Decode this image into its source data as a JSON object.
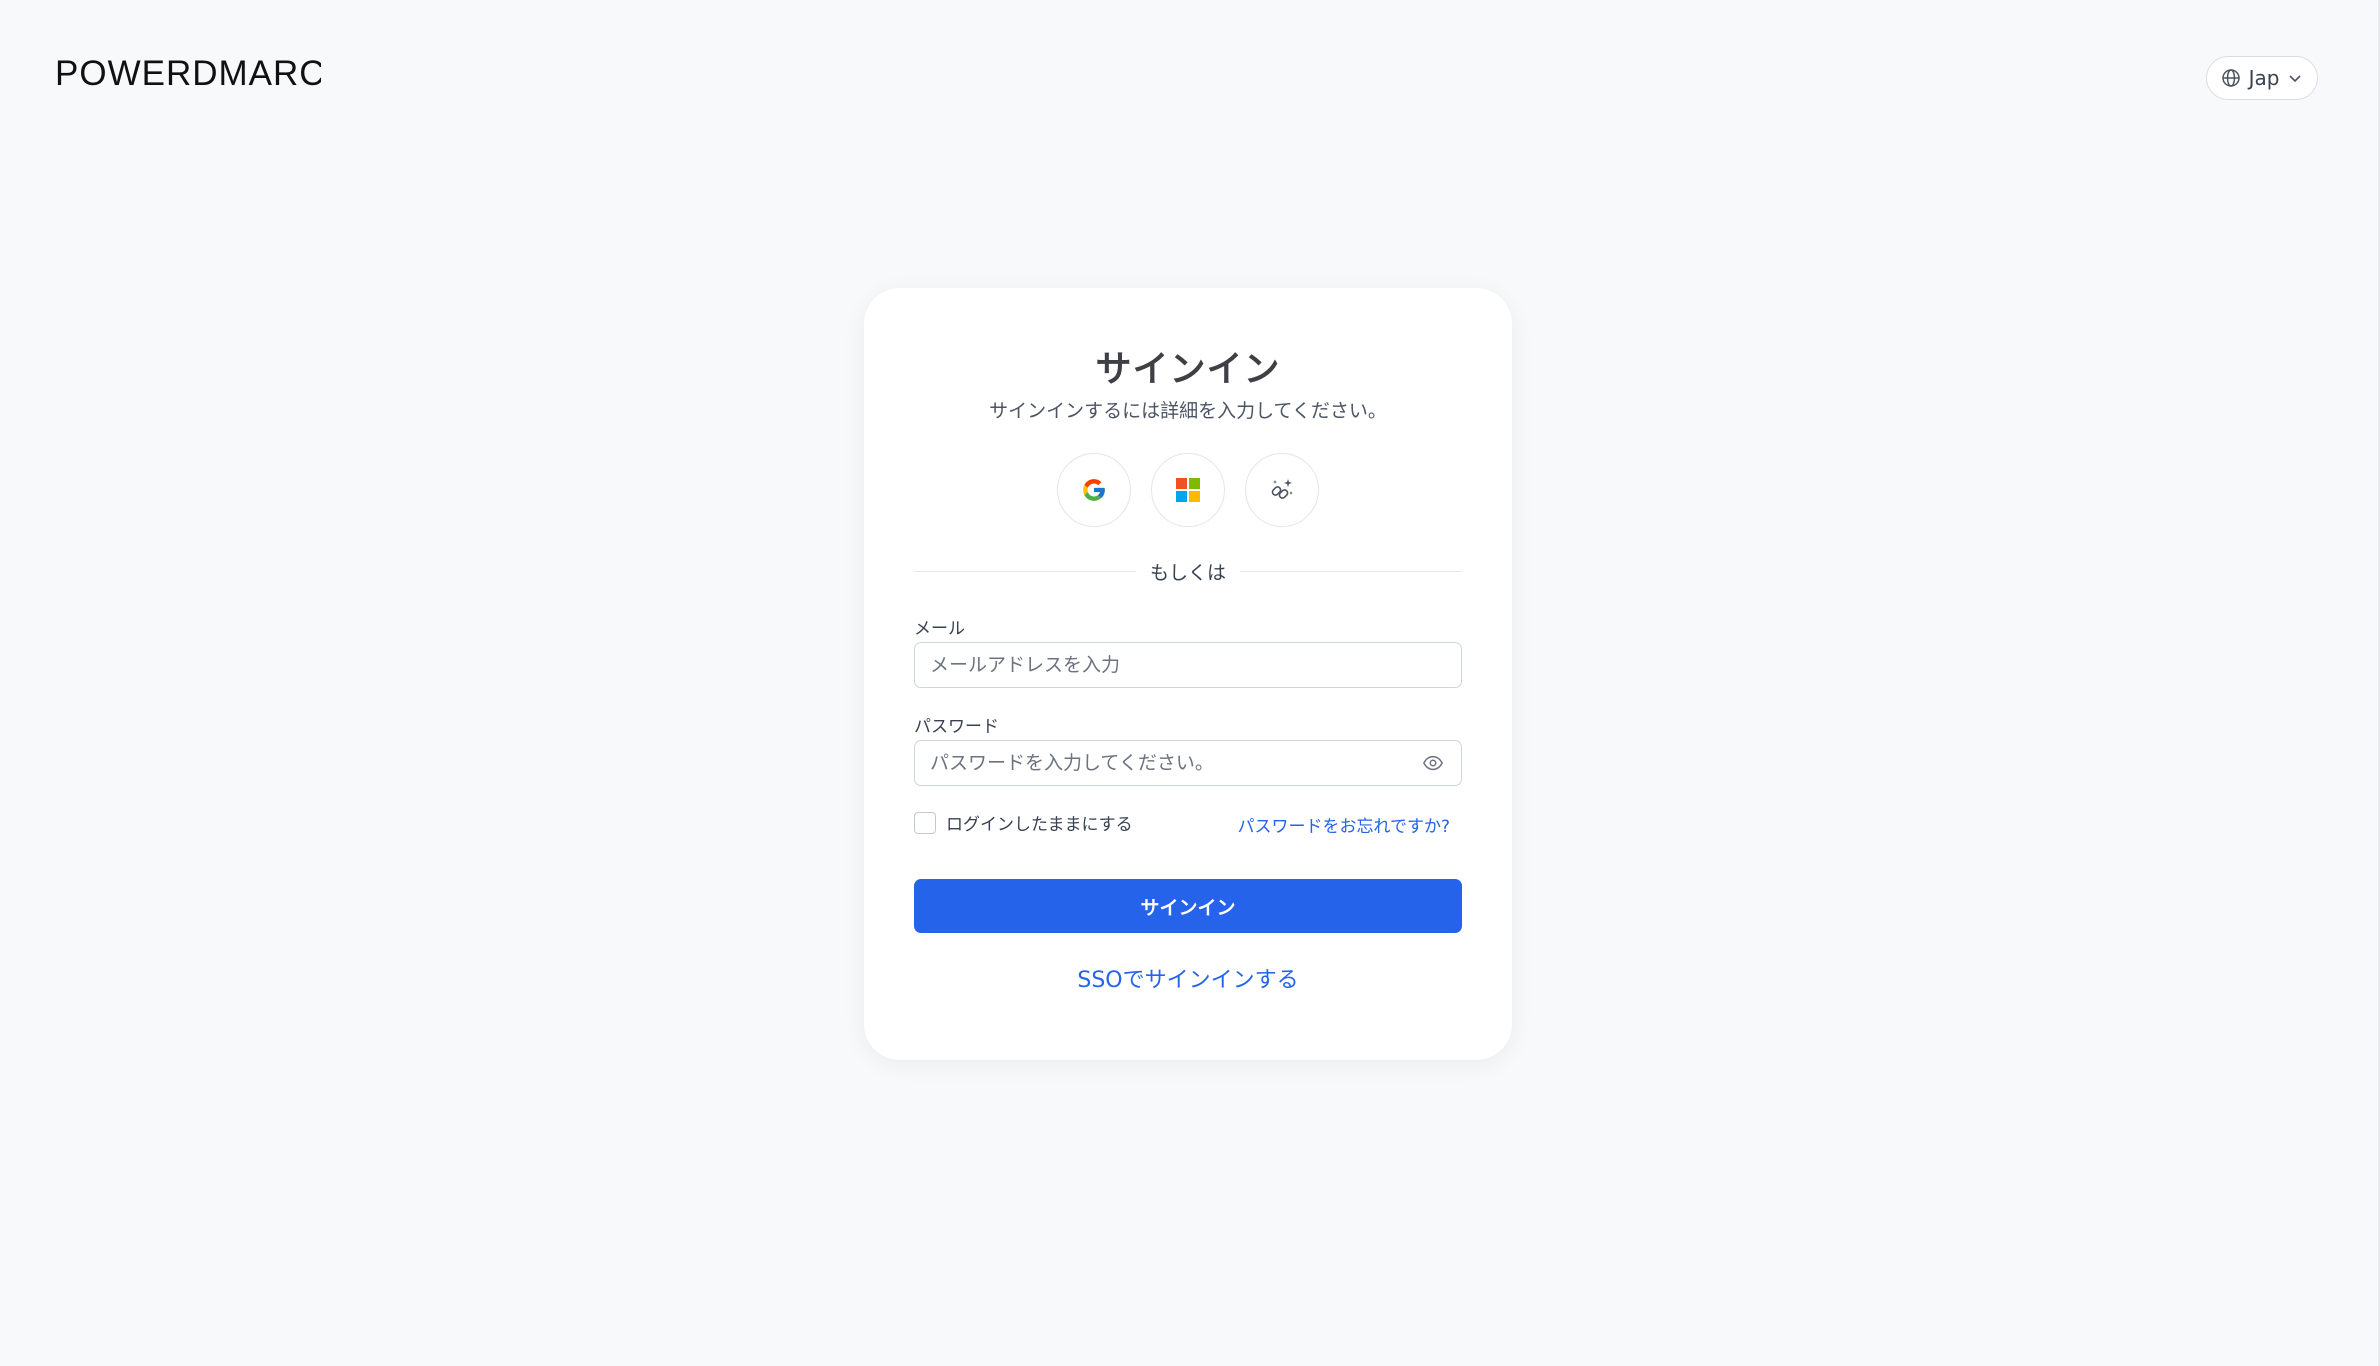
{
  "header": {
    "logo_text": "POWERDMARC",
    "language": {
      "label": "Jap",
      "icon": "globe-icon",
      "chevron_icon": "chevron-down-icon"
    }
  },
  "card": {
    "title": "サインイン",
    "subtitle": "サインインするには詳細を入力してください。",
    "social_buttons": [
      {
        "provider": "Google",
        "icon": "google-icon"
      },
      {
        "provider": "Microsoft",
        "icon": "microsoft-icon"
      },
      {
        "provider": "Magic link",
        "icon": "magic-link-icon"
      }
    ],
    "divider_text": "もしくは",
    "email": {
      "label": "メール",
      "placeholder": "メールアドレスを入力",
      "value": ""
    },
    "password": {
      "label": "パスワード",
      "placeholder": "パスワードを入力してください。",
      "value": "",
      "toggle_icon": "eye-icon"
    },
    "remember_me": {
      "label": "ログインしたままにする",
      "checked": false
    },
    "forgot_password": "パスワードをお忘れですか?",
    "signin_button": "サインイン",
    "sso_link": "SSOでサインインする"
  },
  "colors": {
    "page_background": "#f8f9fb",
    "card_background": "#ffffff",
    "primary": "#2563eb",
    "text": "#374151"
  }
}
